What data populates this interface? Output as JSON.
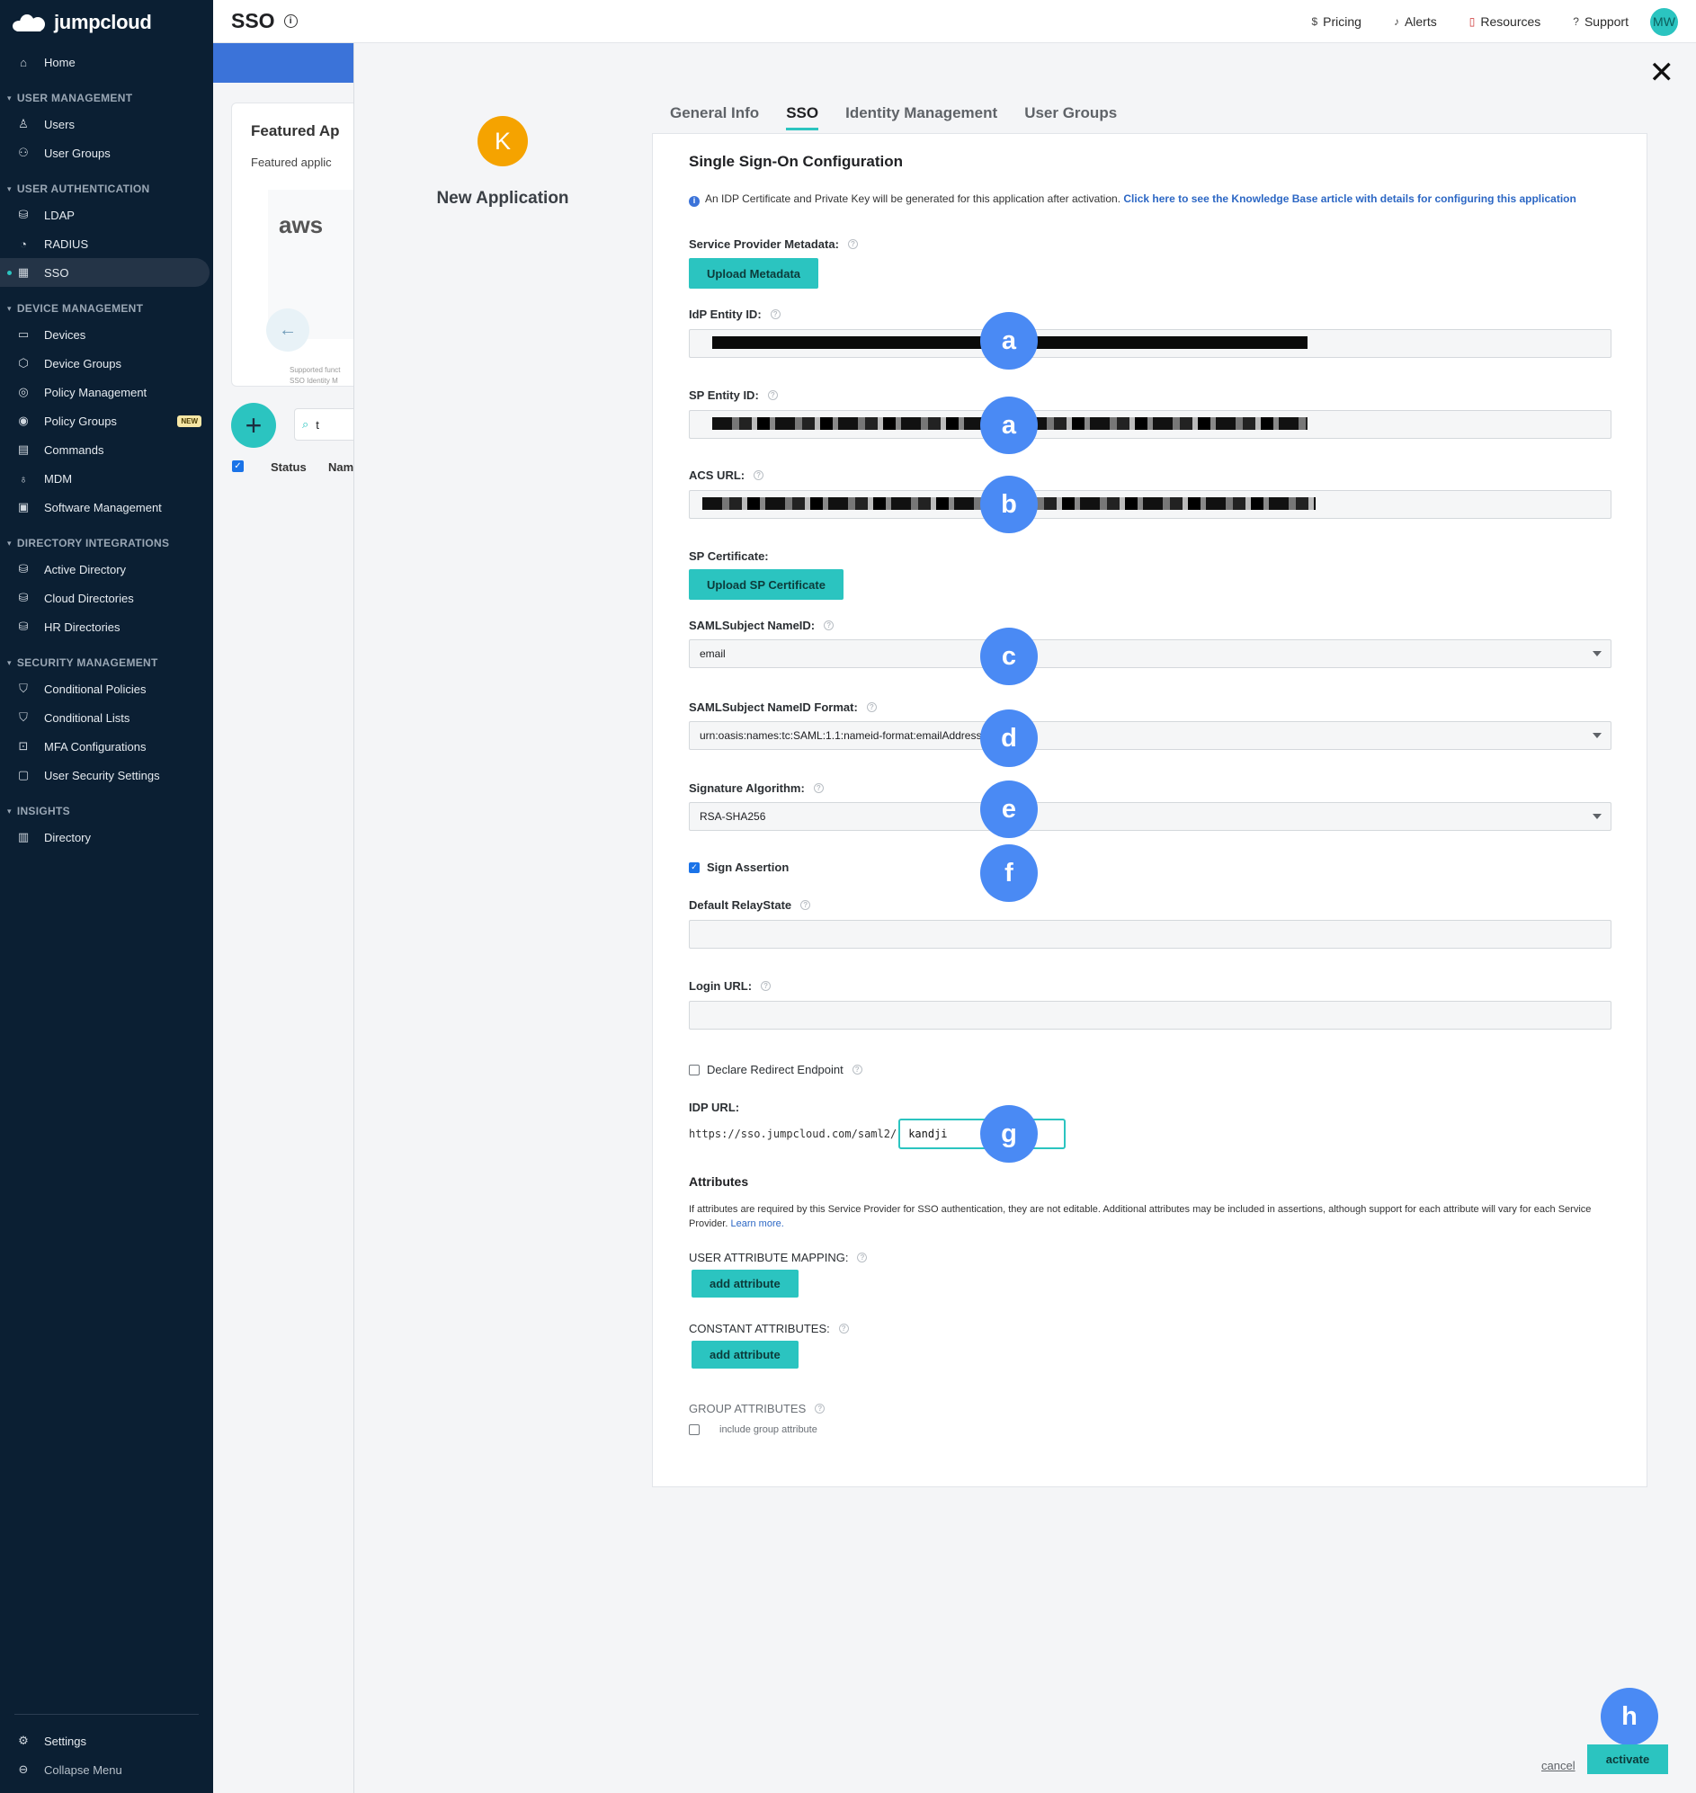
{
  "sidebar": {
    "brand": "jumpcloud",
    "home": "Home",
    "sections": [
      {
        "title": "USER MANAGEMENT",
        "items": [
          "Users",
          "User Groups"
        ]
      },
      {
        "title": "USER AUTHENTICATION",
        "items": [
          "LDAP",
          "RADIUS",
          "SSO"
        ]
      },
      {
        "title": "DEVICE MANAGEMENT",
        "items": [
          "Devices",
          "Device Groups",
          "Policy Management",
          "Policy Groups",
          "Commands",
          "MDM",
          "Software Management"
        ]
      },
      {
        "title": "DIRECTORY INTEGRATIONS",
        "items": [
          "Active Directory",
          "Cloud Directories",
          "HR Directories"
        ]
      },
      {
        "title": "SECURITY MANAGEMENT",
        "items": [
          "Conditional Policies",
          "Conditional Lists",
          "MFA Configurations",
          "User Security Settings"
        ]
      },
      {
        "title": "INSIGHTS",
        "items": [
          "Directory"
        ]
      }
    ],
    "new_badge": "NEW",
    "settings": "Settings",
    "collapse": "Collapse Menu"
  },
  "header": {
    "title": "SSO",
    "links": [
      "Pricing",
      "Alerts",
      "Resources",
      "Support"
    ],
    "avatar": "MW"
  },
  "background_page": {
    "card_title": "Featured Ap",
    "card_subtitle": "Featured applic",
    "logo_text": "aws",
    "supported": "Supported funct",
    "supported2": "SSO   Identity M",
    "search_value": "t",
    "col_status": "Status",
    "col_name": "Nam"
  },
  "modal": {
    "app_initial": "K",
    "app_name": "New Application",
    "tabs": [
      "General Info",
      "SSO",
      "Identity Management",
      "User Groups"
    ],
    "active_tab": "SSO",
    "form": {
      "title": "Single Sign-On Configuration",
      "note_text": "An IDP Certificate and Private Key will be generated for this application after activation.",
      "note_link": "Click here to see the Knowledge Base article with details for configuring this application",
      "sp_metadata_label": "Service Provider Metadata:",
      "upload_metadata": "Upload Metadata",
      "idp_entity_label": "IdP Entity ID:",
      "sp_entity_label": "SP Entity ID:",
      "acs_label": "ACS URL:",
      "sp_cert_label": "SP Certificate:",
      "upload_sp_cert": "Upload SP Certificate",
      "nameid_label": "SAMLSubject NameID:",
      "nameid_value": "email",
      "nameid_format_label": "SAMLSubject NameID Format:",
      "nameid_format_value": "urn:oasis:names:tc:SAML:1.1:nameid-format:emailAddress",
      "sig_alg_label": "Signature Algorithm:",
      "sig_alg_value": "RSA-SHA256",
      "sign_assertion": "Sign Assertion",
      "relay_label": "Default RelayState",
      "login_url_label": "Login URL:",
      "redirect_label": "Declare Redirect Endpoint",
      "idp_url_label": "IDP URL:",
      "idp_url_prefix": "https://sso.jumpcloud.com/saml2/",
      "idp_url_value": "kandji",
      "attributes_title": "Attributes",
      "attributes_note": "If attributes are required by this Service Provider for SSO authentication, they are not editable. Additional attributes may be included in assertions, although support for each attribute will vary for each Service Provider.",
      "learn_more": "Learn more.",
      "user_attr_label": "USER ATTRIBUTE MAPPING:",
      "add_attribute": "add attribute",
      "const_attr_label": "CONSTANT ATTRIBUTES:",
      "group_attr_label": "GROUP ATTRIBUTES",
      "include_group": "include group attribute"
    },
    "callouts": [
      "a",
      "a",
      "b",
      "c",
      "d",
      "e",
      "f",
      "g",
      "h"
    ],
    "cancel": "cancel",
    "activate": "activate"
  },
  "colors": {
    "accent": "#2bc4c0",
    "sidebar": "#0b1f33",
    "callout": "#4a8af4",
    "app_avatar": "#f5a300"
  }
}
